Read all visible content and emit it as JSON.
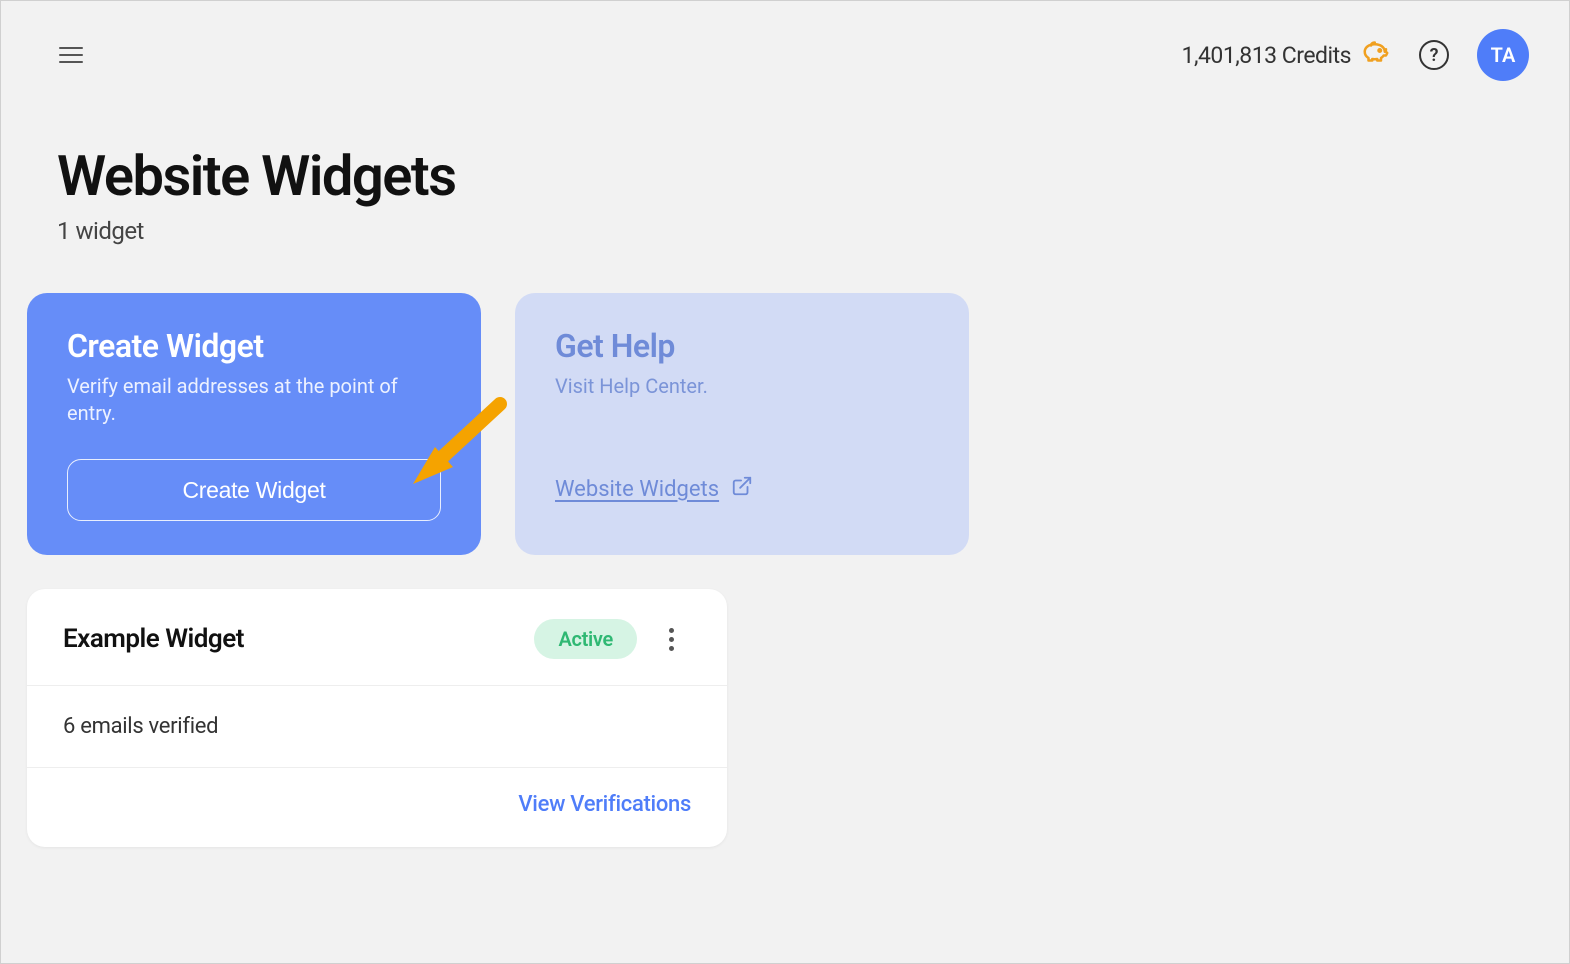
{
  "header": {
    "credits_text": "1,401,813 Credits",
    "avatar_initials": "TA"
  },
  "page": {
    "title": "Website Widgets",
    "subtitle": "1 widget"
  },
  "cards": {
    "create": {
      "title": "Create Widget",
      "description": "Verify email addresses at the point of entry.",
      "button_label": "Create Widget"
    },
    "help": {
      "title": "Get Help",
      "description": "Visit Help Center.",
      "link_label": "Website Widgets"
    }
  },
  "widgets": [
    {
      "name": "Example Widget",
      "status": "Active",
      "summary": "6 emails verified",
      "action_label": "View Verifications"
    }
  ]
}
